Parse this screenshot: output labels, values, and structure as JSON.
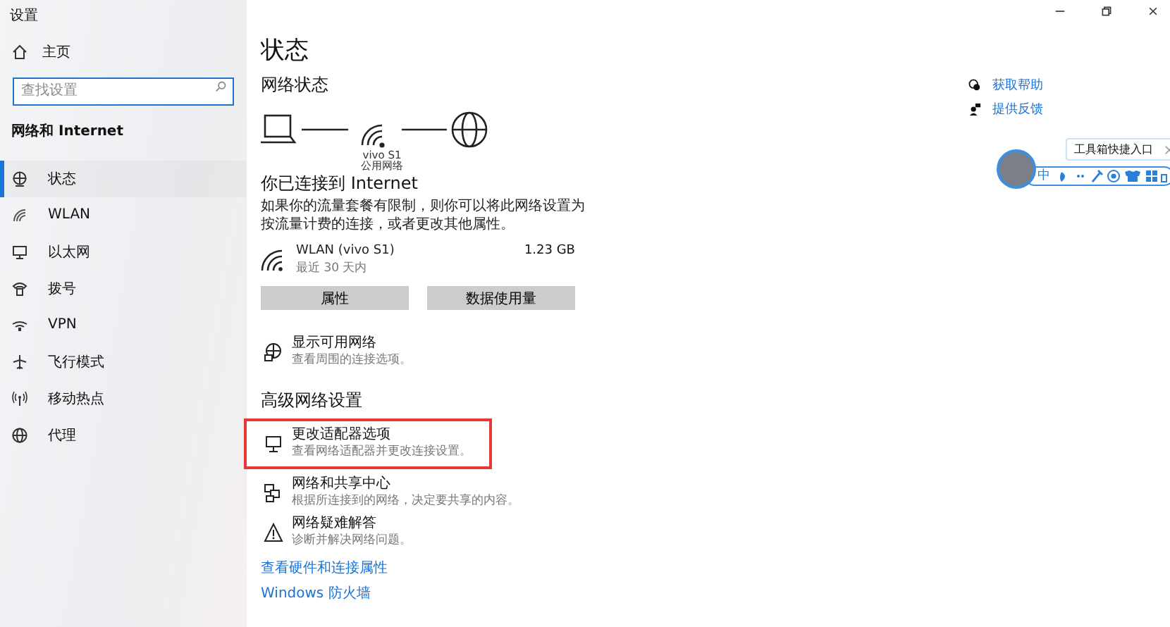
{
  "window": {
    "title": "设置"
  },
  "sidebar": {
    "home": "主页",
    "search": {
      "placeholder": "查找设置"
    },
    "section": "网络和 Internet",
    "items": [
      {
        "label": "状态",
        "selected": true
      },
      {
        "label": "WLAN",
        "selected": false
      },
      {
        "label": "以太网",
        "selected": false
      },
      {
        "label": "拨号",
        "selected": false
      },
      {
        "label": "VPN",
        "selected": false
      },
      {
        "label": "飞行模式",
        "selected": false
      },
      {
        "label": "移动热点",
        "selected": false
      },
      {
        "label": "代理",
        "selected": false
      }
    ]
  },
  "main": {
    "title": "状态",
    "network_heading": "网络状态",
    "diagram": {
      "network_name": "vivo S1",
      "network_type": "公用网络"
    },
    "connected_title": "你已连接到 Internet",
    "connected_text": "如果你的流量套餐有限制，则你可以将此网络设置为按流量计费的连接，或者更改其他属性。",
    "connection": {
      "name": "WLAN (vivo S1)",
      "period": "最近 30 天内",
      "usage": "1.23 GB"
    },
    "buttons": [
      "属性",
      "数据使用量"
    ],
    "show_networks": {
      "title": "显示可用网络",
      "desc": "查看周围的连接选项。"
    },
    "advanced_heading": "高级网络设置",
    "advanced": [
      {
        "title": "更改适配器选项",
        "desc": "查看网络适配器并更改连接设置。",
        "highlighted": true
      },
      {
        "title": "网络和共享中心",
        "desc": "根据所连接到的网络，决定要共享的内容。",
        "highlighted": false
      },
      {
        "title": "网络疑难解答",
        "desc": "诊断并解决网络问题。",
        "highlighted": false
      }
    ],
    "links": [
      "查看硬件和连接属性",
      "Windows 防火墙"
    ]
  },
  "help": [
    {
      "label": "获取帮助"
    },
    {
      "label": "提供反馈"
    }
  ],
  "widget": {
    "tooltip": "工具箱快捷入口",
    "ime_label": "中"
  }
}
